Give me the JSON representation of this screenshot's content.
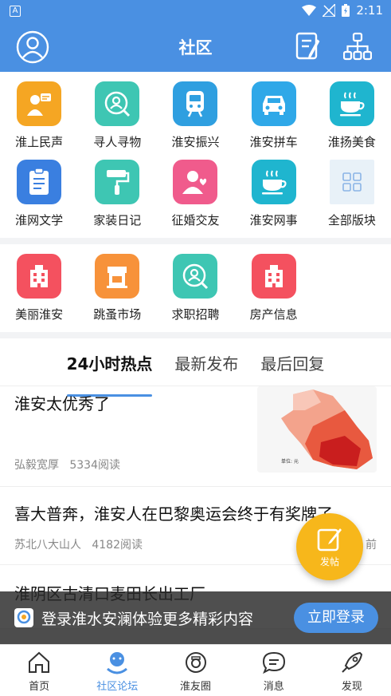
{
  "status": {
    "time": "2:11",
    "app_letter": "A"
  },
  "header": {
    "title": "社区",
    "avatar_icon": "user-avatar-icon",
    "edit_icon": "edit-note-icon",
    "tree_icon": "sitemap-icon"
  },
  "grid": [
    {
      "label": "淮上民声",
      "icon": "megaphone-person-icon",
      "color": "#f5a623"
    },
    {
      "label": "寻人寻物",
      "icon": "search-person-icon",
      "color": "#3ec6b3"
    },
    {
      "label": "淮安振兴",
      "icon": "train-icon",
      "color": "#2f9fe0"
    },
    {
      "label": "淮安拼车",
      "icon": "car-icon",
      "color": "#2fa8e8"
    },
    {
      "label": "淮扬美食",
      "icon": "coffee-cup-icon",
      "color": "#1fb5cf"
    },
    {
      "label": "淮网文学",
      "icon": "clipboard-icon",
      "color": "#3a7fe0"
    },
    {
      "label": "家装日记",
      "icon": "paint-roller-icon",
      "color": "#3ec6b3"
    },
    {
      "label": "征婚交友",
      "icon": "heart-person-icon",
      "color": "#f05b8c"
    },
    {
      "label": "淮安网事",
      "icon": "coffee-cup-icon",
      "color": "#1fb5cf"
    },
    {
      "label": "全部版块",
      "icon": "grid-icon",
      "color": "#e8f1f8"
    }
  ],
  "grid2": [
    {
      "label": "美丽淮安",
      "icon": "building-icon",
      "color": "#f4515f"
    },
    {
      "label": "跳蚤市场",
      "icon": "shop-icon",
      "color": "#f7923a"
    },
    {
      "label": "求职招聘",
      "icon": "search-person-icon",
      "color": "#3ec6b3"
    },
    {
      "label": "房产信息",
      "icon": "building-icon",
      "color": "#f4515f"
    }
  ],
  "tabs": [
    {
      "label": "24小时热点",
      "active": true
    },
    {
      "label": "最新发布",
      "active": false
    },
    {
      "label": "最后回复",
      "active": false
    }
  ],
  "posts": [
    {
      "title": "淮安太优秀了",
      "author": "弘毅宽厚",
      "reads": "5334阅读"
    },
    {
      "title": "喜大普奔，淮安人在巴黎奥运会终于有奖牌了",
      "author": "苏北八大山人",
      "reads": "4182阅读",
      "time": "前"
    },
    {
      "title": "淮阴区古清口麦田长出工厂"
    }
  ],
  "fab": {
    "label": "发帖"
  },
  "banner": {
    "text": "登录淮水安澜体验更多精彩内容",
    "button": "立即登录"
  },
  "nav": [
    {
      "label": "首页",
      "icon": "home-icon",
      "active": false
    },
    {
      "label": "社区论坛",
      "icon": "community-icon",
      "active": true
    },
    {
      "label": "淮友圈",
      "icon": "camera-circle-icon",
      "active": false
    },
    {
      "label": "消息",
      "icon": "chat-bubble-icon",
      "active": false
    },
    {
      "label": "发现",
      "icon": "rocket-icon",
      "active": false
    }
  ]
}
